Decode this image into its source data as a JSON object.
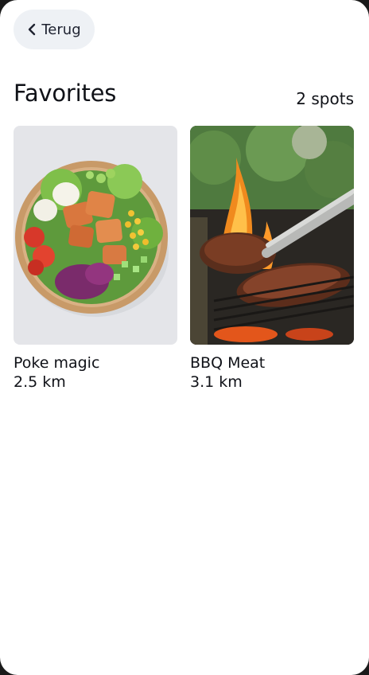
{
  "nav": {
    "back_label": "Terug"
  },
  "header": {
    "title": "Favorites",
    "count": "2 spots"
  },
  "favorites": [
    {
      "name": "Poke magic",
      "distance": "2.5 km",
      "image": "poke-bowl-photo"
    },
    {
      "name": "BBQ Meat",
      "distance": "3.1 km",
      "image": "bbq-grill-photo"
    }
  ],
  "colors": {
    "background": "#ffffff",
    "button_bg": "#eef1f5",
    "text": "#101218"
  }
}
